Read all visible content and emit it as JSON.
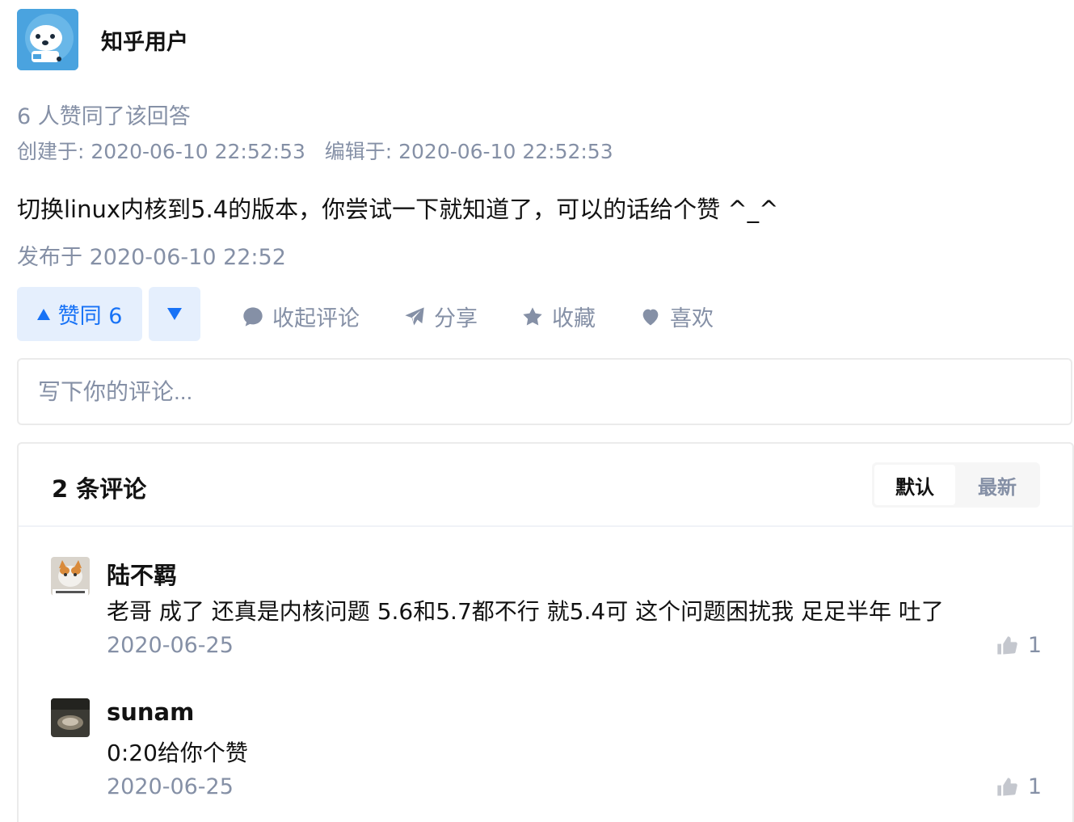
{
  "author": {
    "name": "知乎用户",
    "avatar_icon": "zhihu-default-avatar-icon"
  },
  "answer": {
    "vote_summary": "6 人赞同了该回答",
    "dates_line": "创建于: 2020-06-10 22:52:53   编辑于: 2020-06-10 22:52:53",
    "body": "切换linux内核到5.4的版本，你尝试一下就知道了，可以的话给个赞 ^_^",
    "published": "发布于 2020-06-10 22:52"
  },
  "actions": {
    "vote_up_label": "赞同 6",
    "collapse_comments": "收起评论",
    "share": "分享",
    "collect": "收藏",
    "like": "喜欢"
  },
  "comment_input": {
    "placeholder": "写下你的评论..."
  },
  "comments": {
    "count_label": "2 条评论",
    "sort_default": "默认",
    "sort_latest": "最新",
    "items": [
      {
        "author": "陆不羁",
        "text": "老哥 成了 还真是内核问题 5.6和5.7都不行 就5.4可 这个问题困扰我 足足半年 吐了",
        "date": "2020-06-25",
        "likes": "1"
      },
      {
        "author": "sunam",
        "text": "0:20给你个赞",
        "date": "2020-06-25",
        "likes": "1"
      }
    ]
  },
  "colors": {
    "brand_blue": "#1772f6",
    "vote_bg": "#e5effd",
    "meta_gray": "#8590a6"
  }
}
